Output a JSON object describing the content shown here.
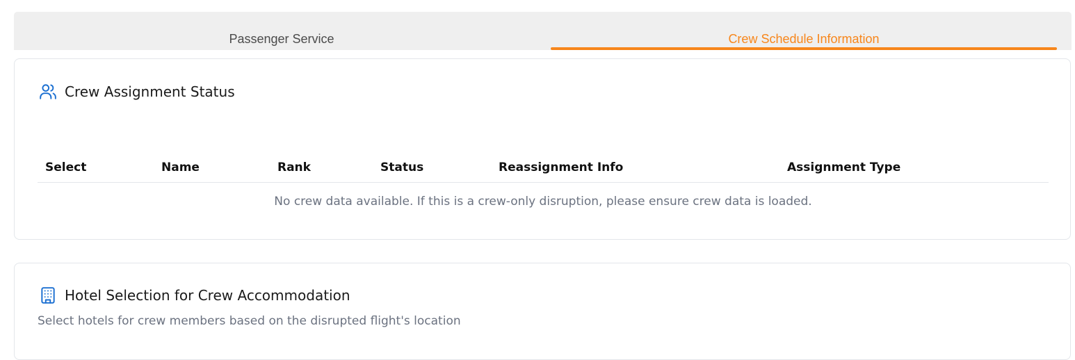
{
  "tabs": {
    "passenger_service": "Passenger Service",
    "crew_schedule": "Crew Schedule Information"
  },
  "crew_card": {
    "title": "Crew Assignment Status",
    "icon": "users-icon",
    "columns": [
      "Select",
      "Name",
      "Rank",
      "Status",
      "Reassignment Info",
      "Assignment Type"
    ],
    "empty_message": "No crew data available. If this is a crew-only disruption, please ensure crew data is loaded."
  },
  "hotel_card": {
    "title": "Hotel Selection for Crew Accommodation",
    "icon": "building-icon",
    "subtitle": "Select hotels for crew members based on the disrupted flight's location"
  },
  "colors": {
    "accent": "#f7861b",
    "icon_blue": "#1b6fd1",
    "muted_text": "#6b7280"
  }
}
